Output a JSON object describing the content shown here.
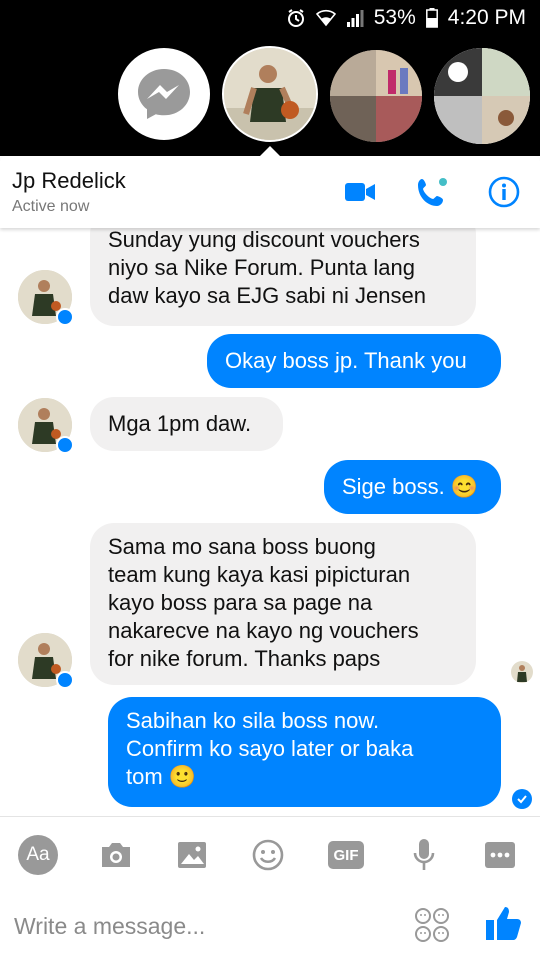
{
  "status_bar": {
    "battery": "53%",
    "time": "4:20 PM",
    "icons": [
      "alarm-icon",
      "wifi-icon",
      "signal-icon",
      "battery-icon"
    ]
  },
  "chat_heads": [
    "messenger-icon",
    "contact-avatar",
    "group-avatar-1",
    "group-avatar-2"
  ],
  "header": {
    "name": "Jp Redelick",
    "status": "Active now",
    "actions": [
      "video-call-icon",
      "voice-call-icon",
      "info-icon"
    ]
  },
  "messages": [
    {
      "from": "them",
      "text": "Sunday yung discount vouchers\nniyo sa Nike Forum. Punta lang\ndaw kayo sa EJG sabi ni Jensen"
    },
    {
      "from": "me",
      "text": "Okay boss jp. Thank you"
    },
    {
      "from": "them",
      "text": "Mga 1pm daw."
    },
    {
      "from": "me",
      "text": "Sige boss. 😊"
    },
    {
      "from": "them",
      "text": "Sama mo sana boss buong\nteam kung kaya kasi pipicturan\nkayo boss para sa page na\nnakarecve na kayo ng vouchers\nfor nike forum. Thanks paps"
    },
    {
      "from": "me",
      "text": "Sabihan ko sila boss now.\nConfirm ko sayo later or baka\ntom 🙂"
    }
  ],
  "composer": {
    "placeholder": "Write a message...",
    "tools": [
      "text-size-icon",
      "camera-icon",
      "gallery-icon",
      "emoji-icon",
      "gif-icon",
      "microphone-icon",
      "more-icon"
    ],
    "aa_label": "Aa",
    "gif_label": "GIF"
  },
  "colors": {
    "accent": "#0084ff",
    "incoming_bubble": "#f1f0f0",
    "status_bar": "#000000"
  }
}
